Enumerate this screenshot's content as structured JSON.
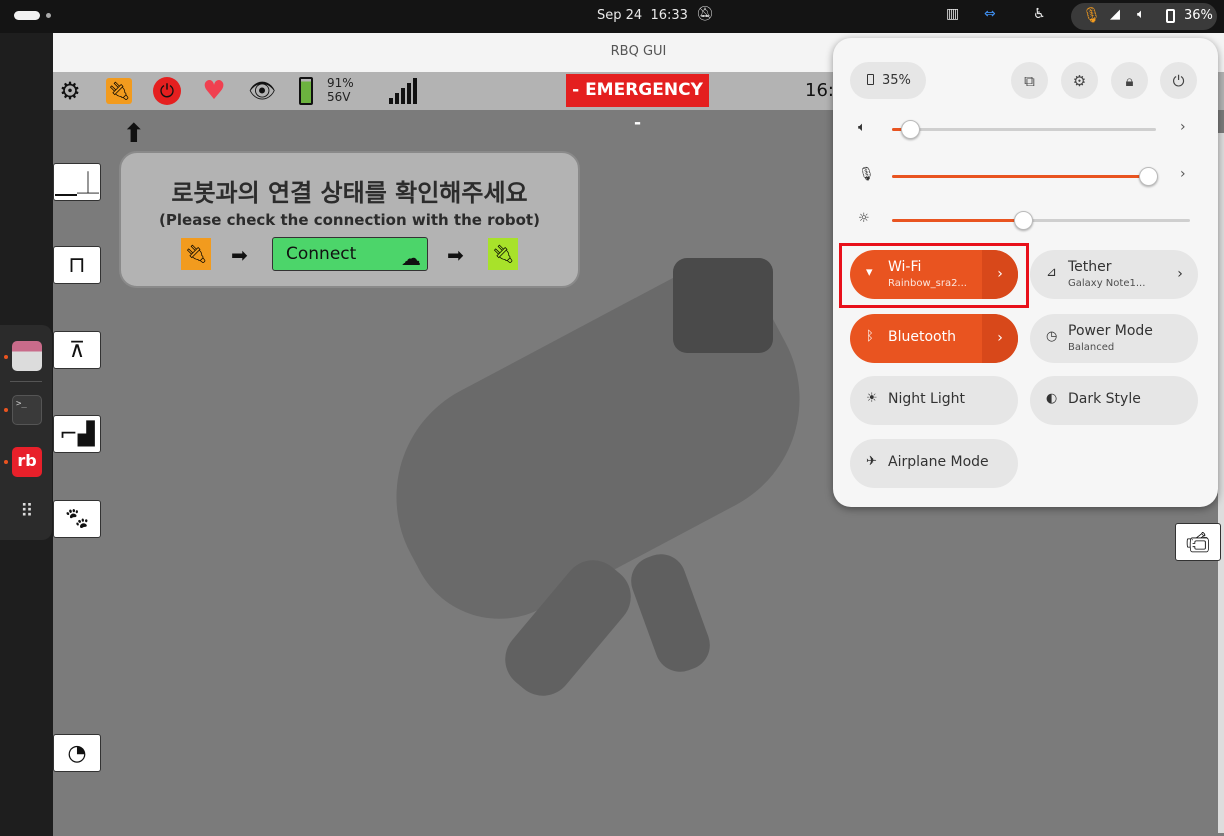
{
  "topbar": {
    "date": "Sep 24",
    "time": "16:33",
    "battery_percent": "36%"
  },
  "dock": {
    "apps": [
      "files",
      "terminal",
      "rbq",
      "show-apps"
    ],
    "rb_label": "rb",
    "terminal_glyph": ">_"
  },
  "window": {
    "title": "RBQ GUI"
  },
  "toolbar": {
    "battery_percent": "91%",
    "battery_voltage": "56V",
    "emergency_label": "- EMERGENCY -",
    "time_truncated": "16:"
  },
  "notice": {
    "korean": "로봇과의 연결 상태를 확인해주세요",
    "english_prefix": "(Please check the ",
    "english_bold": "connection",
    "english_suffix": " with the robot)",
    "connect_label": "Connect"
  },
  "quick_settings": {
    "battery_label": "35%",
    "volume_level": 0.07,
    "mic_level": 0.97,
    "brightness_level": 0.44,
    "tiles": [
      {
        "id": "wifi",
        "label": "Wi-Fi",
        "subtitle": "Rainbow_sra2...",
        "on": true,
        "icon": "wifi-icon"
      },
      {
        "id": "tether",
        "label": "Tether",
        "subtitle": "Galaxy Note1...",
        "on": false,
        "icon": "tether-icon"
      },
      {
        "id": "bluetooth",
        "label": "Bluetooth",
        "subtitle": "",
        "on": true,
        "icon": "bluetooth-icon"
      },
      {
        "id": "power-mode",
        "label": "Power Mode",
        "subtitle": "Balanced",
        "on": false,
        "icon": "power-mode-icon"
      },
      {
        "id": "night-light",
        "label": "Night Light",
        "subtitle": "",
        "on": false,
        "icon": "night-light-icon"
      },
      {
        "id": "dark-style",
        "label": "Dark Style",
        "subtitle": "",
        "on": false,
        "icon": "dark-style-icon"
      },
      {
        "id": "airplane",
        "label": "Airplane Mode",
        "subtitle": "",
        "on": false,
        "icon": "airplane-icon"
      }
    ]
  },
  "colors": {
    "accent": "#e95420",
    "emergency": "#e41f1f",
    "connect": "#4cd56a",
    "highlight": "#e8101a"
  }
}
